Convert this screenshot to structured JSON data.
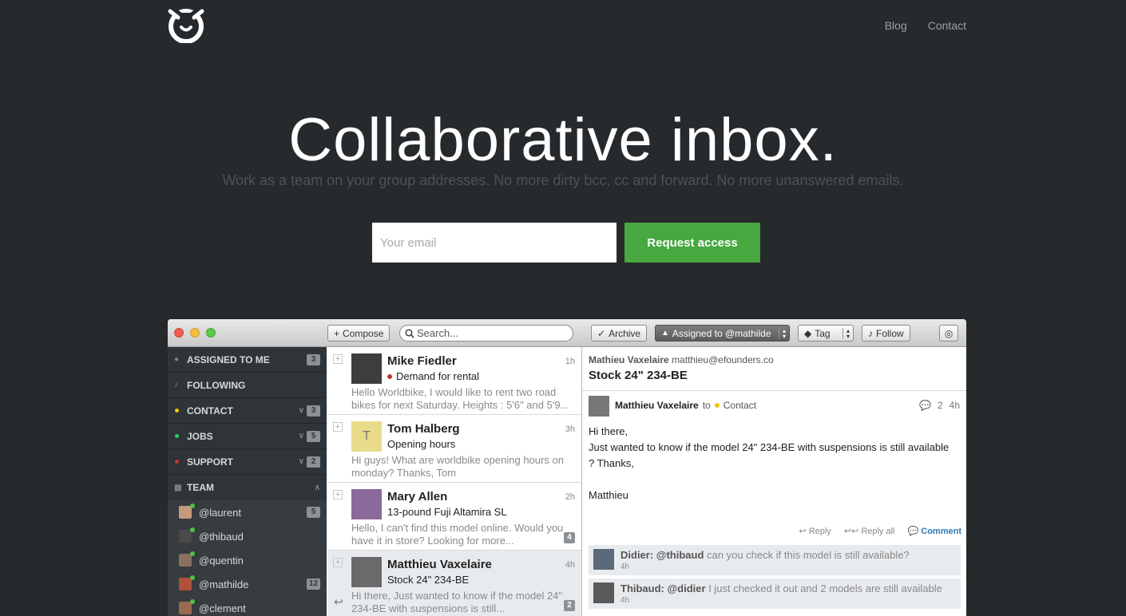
{
  "nav": {
    "blog": "Blog",
    "contact": "Contact"
  },
  "hero": {
    "title": "Collaborative inbox.",
    "subtitle": "Work as a team on your group addresses. No more dirty bcc, cc and forward. No more unanswered emails.",
    "email_placeholder": "Your email",
    "cta": "Request access"
  },
  "colors": {
    "background": "#262a2c",
    "cta": "#46a83f",
    "sidebar": "#2f3438"
  },
  "toolbar": {
    "compose": "Compose",
    "search_placeholder": "Search...",
    "archive": "Archive",
    "assigned": "Assigned to @mathilde",
    "tag": "Tag",
    "follow": "Follow"
  },
  "sidebar": {
    "items": [
      {
        "label": "ASSIGNED TO ME",
        "badge": "3"
      },
      {
        "label": "FOLLOWING"
      },
      {
        "label": "CONTACT",
        "badge": "3",
        "dot": "#f1c40f"
      },
      {
        "label": "JOBS",
        "badge": "5",
        "dot": "#2ecc71"
      },
      {
        "label": "SUPPORT",
        "badge": "2",
        "dot": "#c0392b"
      },
      {
        "label": "TEAM"
      }
    ],
    "team": [
      {
        "name": "@laurent",
        "badge": "5"
      },
      {
        "name": "@thibaud"
      },
      {
        "name": "@quentin"
      },
      {
        "name": "@mathilde",
        "badge": "12"
      },
      {
        "name": "@clement"
      }
    ]
  },
  "messages": [
    {
      "name": "Mike Fiedler",
      "time": "1h",
      "subject": "Demand for rental",
      "preview": "Hello Worldbike, I would like to rent two road bikes for next Saturday. Heights : 5'6\" and 5'9..."
    },
    {
      "name": "Tom Halberg",
      "initial": "T",
      "time": "3h",
      "subject": "Opening hours",
      "preview": "Hi guys! What are worldbike opening hours on monday? Thanks, Tom"
    },
    {
      "name": "Mary Allen",
      "time": "2h",
      "subject": "13-pound Fuji Altamira SL",
      "preview": "Hello, I can't find this model online. Would you have it in store? Looking for more...",
      "count": "4"
    },
    {
      "name": "Matthieu Vaxelaire",
      "time": "4h",
      "subject": "Stock 24\" 234-BE",
      "preview": "Hi there, Just wanted to know if the model 24\" 234-BE with suspensions is still...",
      "count": "2"
    }
  ],
  "detail": {
    "from_name": "Mathieu Vaxelaire",
    "from_email": "matthieu@efounders.co",
    "title": "Stock 24\" 234-BE",
    "sender": "Matthieu Vaxelaire",
    "to": "to",
    "inbox": "Contact",
    "comments_count": "2",
    "time": "4h",
    "body": [
      "Hi there,",
      "Just wanted to know if the model 24\" 234-BE with suspensions is still available",
      "? Thanks,",
      "",
      "Matthieu"
    ],
    "reply": "Reply",
    "reply_all": "Reply all",
    "comment": "Comment",
    "comments": [
      {
        "author": "Didier: @thibaud",
        "text": "can you check if this model is still available?",
        "time": "4h"
      },
      {
        "author": "Thibaud: @didier",
        "text": "I just checked it out and 2 models are still available",
        "time": "4h"
      }
    ]
  }
}
